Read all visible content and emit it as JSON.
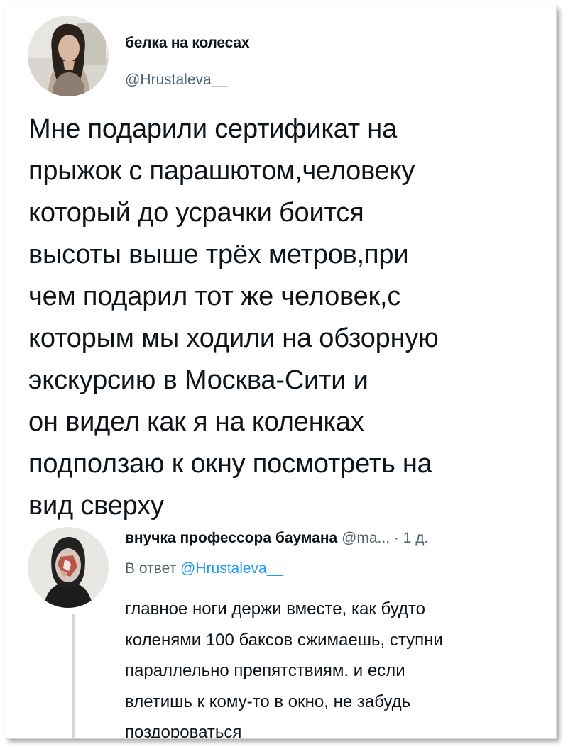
{
  "tweet": {
    "display_name": "белка на колесах",
    "handle": "@Hrustaleva__",
    "text_lines": [
      "Мне подарили сертификат на",
      "прыжок с парашютом,человеку",
      "который до усрачки боится",
      "высоты выше трёх метров,при",
      "чем подарил тот же человек,с",
      "которым мы ходили на обзорную",
      "экскурсию в Москва-Сити и",
      "он видел как я на коленках",
      "подползаю к окну посмотреть на",
      "вид сверху"
    ]
  },
  "reply": {
    "display_name": "внучка профессора баумана",
    "handle": "@ma...",
    "separator": "·",
    "time": "1 д.",
    "reply_prefix": "В ответ",
    "reply_mention": "@Hrustaleva__",
    "text_lines": [
      "главное ноги держи вместе, как будто",
      "коленями 100 баксов сжимаешь, ступни",
      "параллельно препятствиям. и если",
      "влетишь к кому-то в окно, не забудь",
      "поздороваться"
    ]
  },
  "colors": {
    "text": "#0f1419",
    "secondary_text": "#536471",
    "mention": "#1d9bf0",
    "thread_line": "#cfd9de"
  },
  "icons": [
    "profile-avatar",
    "reply-avatar"
  ]
}
